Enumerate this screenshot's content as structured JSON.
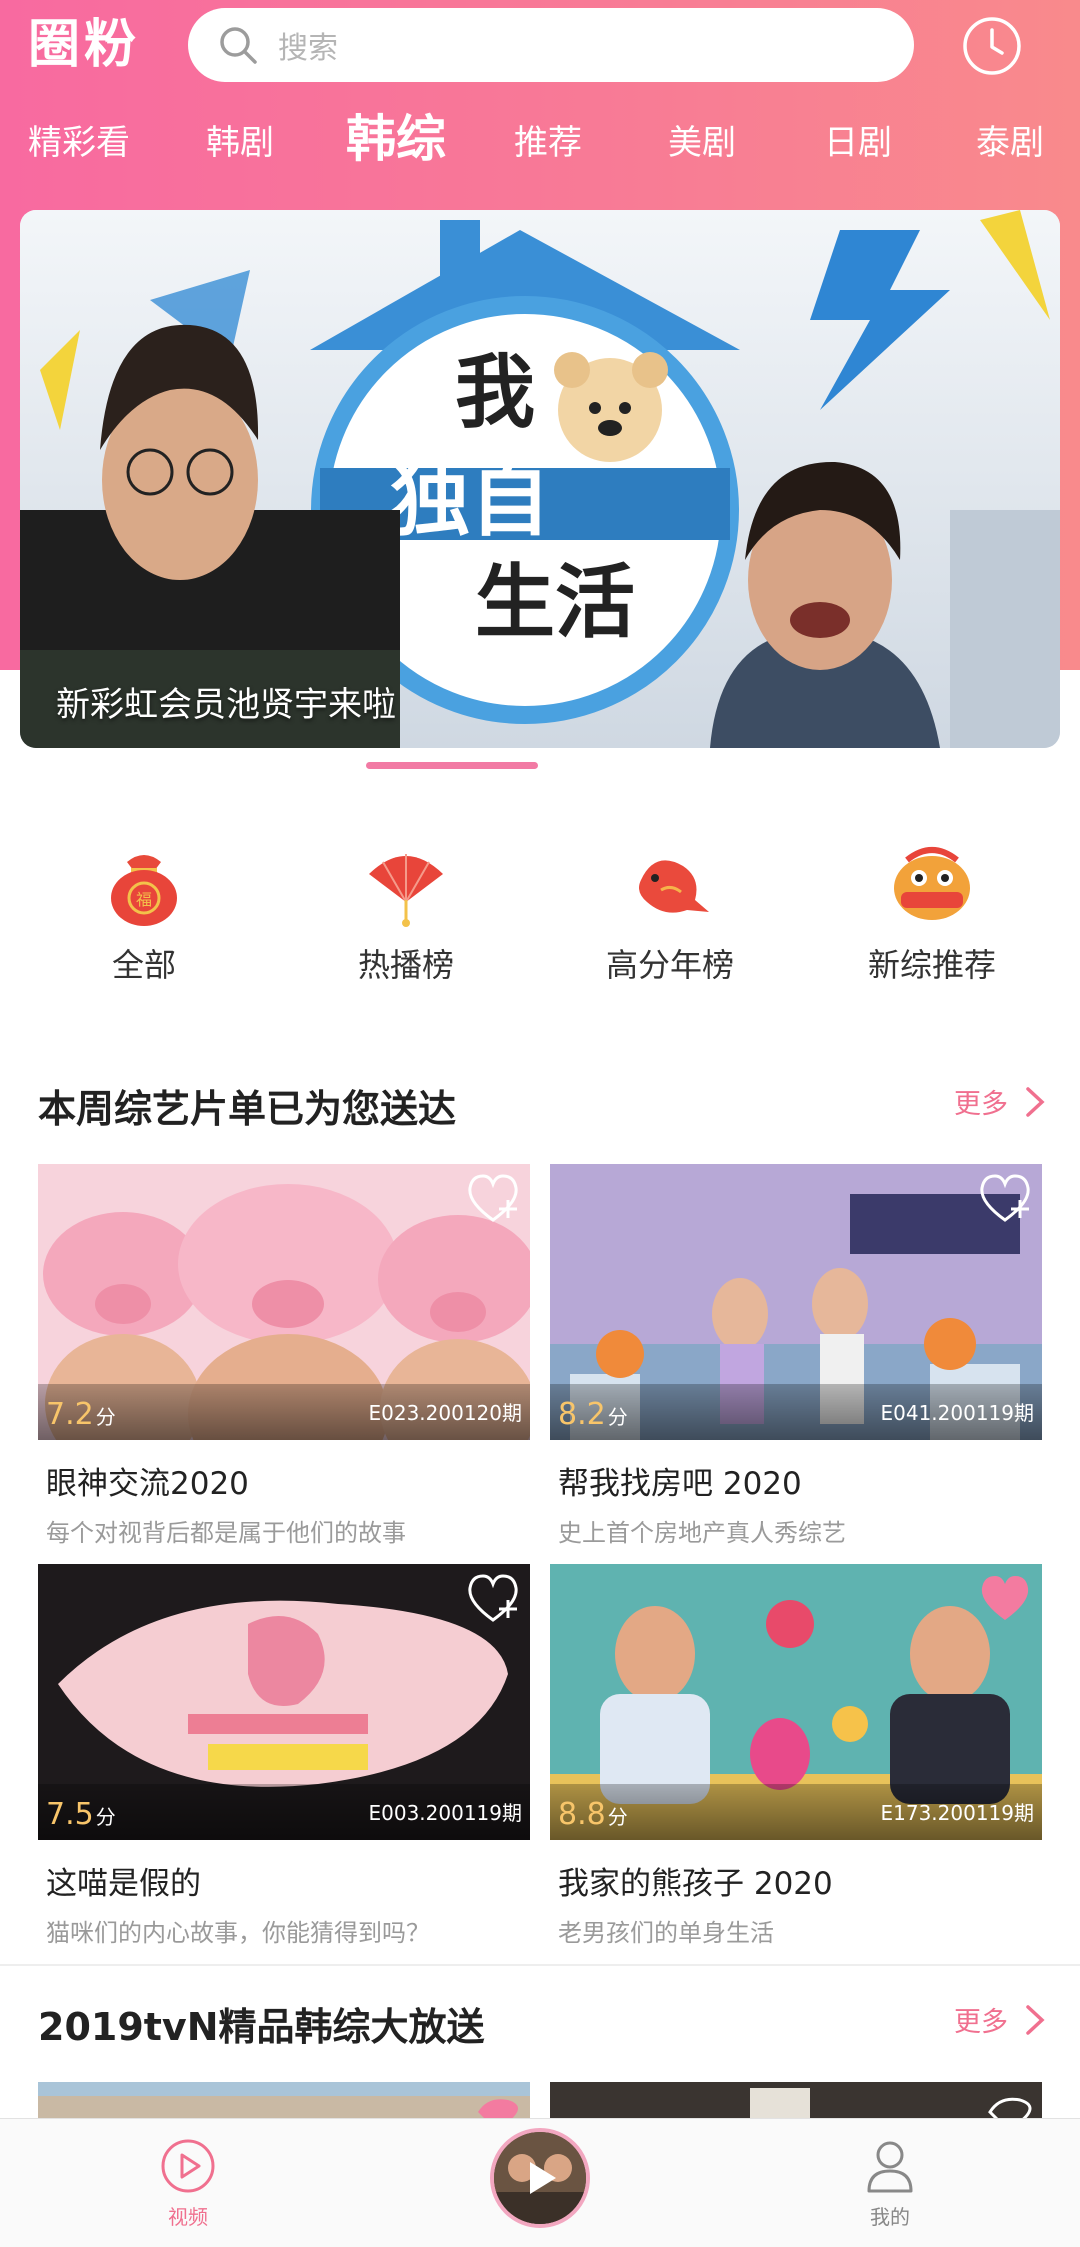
{
  "app": {
    "logo": "圈粉",
    "search_placeholder": "搜索",
    "accent_color": "#f0708f"
  },
  "tabs": [
    {
      "label": "精彩看",
      "active": false
    },
    {
      "label": "韩剧",
      "active": false
    },
    {
      "label": "韩综",
      "active": true
    },
    {
      "label": "推荐",
      "active": false
    },
    {
      "label": "美剧",
      "active": false
    },
    {
      "label": "日剧",
      "active": false
    },
    {
      "label": "泰剧",
      "active": false
    }
  ],
  "banner": {
    "caption": "新彩虹会员池贤宇来啦",
    "art_text": [
      "我",
      "独自",
      "生活"
    ]
  },
  "categories": [
    {
      "label": "全部",
      "icon": "lucky-bag-icon",
      "icon_text": "福"
    },
    {
      "label": "热播榜",
      "icon": "fan-icon"
    },
    {
      "label": "高分年榜",
      "icon": "koi-fish-icon"
    },
    {
      "label": "新综推荐",
      "icon": "lion-dance-icon"
    }
  ],
  "section1": {
    "title": "本周综艺片单已为您送达",
    "more_label": "更多",
    "cards": [
      {
        "score": "7.2",
        "score_unit": "分",
        "episode": "E023.200120期",
        "title": "眼神交流2020",
        "subtitle": "每个对视背后都是属于他们的故事",
        "favorited": false
      },
      {
        "score": "8.2",
        "score_unit": "分",
        "episode": "E041.200119期",
        "title": "帮我找房吧 2020",
        "subtitle": "史上首个房地产真人秀综艺",
        "favorited": false
      },
      {
        "score": "7.5",
        "score_unit": "分",
        "episode": "E003.200119期",
        "title": "这喵是假的",
        "subtitle": "猫咪们的内心故事，你能猜得到吗？",
        "favorited": false
      },
      {
        "score": "8.8",
        "score_unit": "分",
        "episode": "E173.200119期",
        "title": "我家的熊孩子 2020",
        "subtitle": "老男孩们的单身生活",
        "favorited": true
      }
    ]
  },
  "section2": {
    "title": "2019tvN精品韩综大放送",
    "more_label": "更多"
  },
  "bottom_nav": {
    "video_label": "视频",
    "mine_label": "我的",
    "active_color": "#f0708f",
    "inactive_color": "#888888"
  }
}
